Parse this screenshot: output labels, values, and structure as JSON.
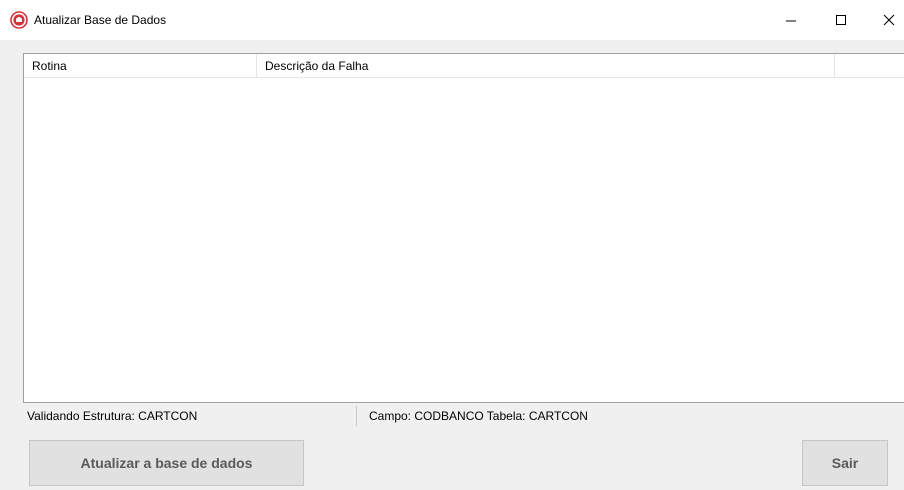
{
  "window": {
    "title": "Atualizar Base de Dados",
    "icon": "app-logo-icon",
    "controls": [
      "minimize-icon",
      "maximize-icon",
      "close-icon"
    ]
  },
  "list": {
    "columns": [
      "Rotina",
      "Descrição da Falha",
      ""
    ],
    "rows": []
  },
  "status": {
    "left": "Validando Estrutura: CARTCON",
    "right": "Campo: CODBANCO Tabela: CARTCON"
  },
  "buttons": {
    "update_label": "Atualizar a base de dados",
    "exit_label": "Sair"
  },
  "colors": {
    "accent_icon": "#d13438",
    "window_bg": "#f0f0f0",
    "button_bg": "#e1e1e1"
  }
}
